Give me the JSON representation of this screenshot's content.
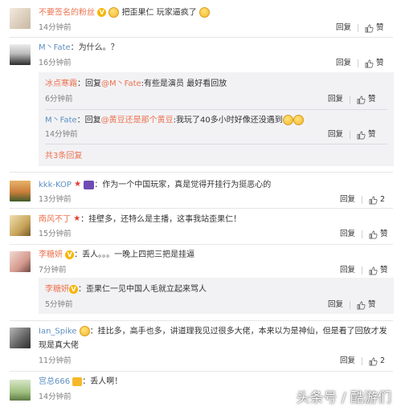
{
  "comments": [
    {
      "user": "不要签名的粉丝",
      "text": "把歪果仁   玩家逼疯了",
      "time": "14分钟前",
      "reply": "回复",
      "like": "赞"
    },
    {
      "user": "M丶Fate",
      "text": "：为什么。？",
      "time": "16分钟前",
      "reply": "回复",
      "like": "赞",
      "replies": [
        {
          "user": "冰点寒霜",
          "prefix": "：回复",
          "mention": "@M丶Fate",
          "text": ":有些是演员 最好看回放",
          "time": "6分钟前",
          "reply": "回复",
          "like": "赞"
        },
        {
          "user": "M丶Fate",
          "prefix": "：回复",
          "mention": "@黄豆还是那个黄豆",
          "text": ":我玩了40多小时好像还没遇到",
          "time": "14分钟前",
          "reply": "回复",
          "like": "赞"
        }
      ],
      "more": "共3条回复"
    },
    {
      "user": "kkk-KOP",
      "text": "：作为一个中国玩家，真是觉得开挂行为挺恶心的",
      "time": "13分钟前",
      "reply": "回复",
      "like_count": "2"
    },
    {
      "user": "南风不丁",
      "text": "：挂壁多，还特么是主播，这事我站歪果仁！",
      "time": "15分钟前",
      "reply": "回复",
      "like": "赞"
    },
    {
      "user": "李糖妍",
      "text": "：丢人。。。一晚上四把三把是挂逼",
      "time": "7分钟前",
      "reply": "回复",
      "like": "赞",
      "replies": [
        {
          "user": "李糖妍",
          "text": "：歪果仁一见中国人毛就立起来骂人",
          "time": "5分钟前",
          "reply": "回复",
          "like": "赞"
        }
      ]
    },
    {
      "user": "Ian_Spike",
      "text": "：挂比多，高手也多，讲道理我见过很多大佬，本来以为是神仙，但是看了回放才发",
      "text2": "现是真大佬",
      "time": "11分钟前",
      "reply": "回复",
      "like_count": "2"
    },
    {
      "user": "宫总666",
      "text": "：丢人啊！",
      "time": "14分钟前",
      "reply": "",
      "like": ""
    }
  ],
  "watermark": "头条号 / 酷游们"
}
